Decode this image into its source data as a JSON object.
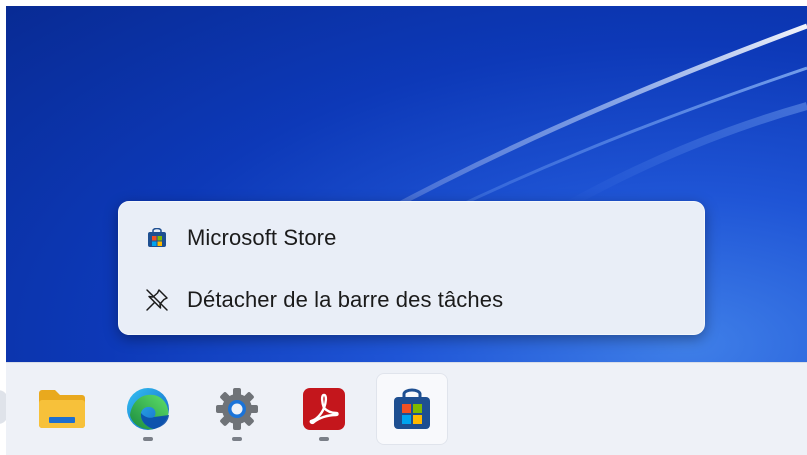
{
  "context_menu": {
    "items": [
      {
        "label": "Microsoft Store",
        "icon": "microsoft-store-icon"
      },
      {
        "label": "Détacher de la barre des tâches",
        "icon": "unpin-icon"
      }
    ]
  },
  "taskbar": {
    "items": [
      {
        "name": "file-explorer",
        "icon": "folder-icon",
        "running": false
      },
      {
        "name": "microsoft-edge",
        "icon": "edge-icon",
        "running": true
      },
      {
        "name": "settings",
        "icon": "gear-icon",
        "running": true
      },
      {
        "name": "acrobat-reader",
        "icon": "pdf-icon",
        "running": true
      },
      {
        "name": "microsoft-store",
        "icon": "microsoft-store-icon",
        "running": false,
        "active": true
      }
    ]
  },
  "colors": {
    "desktop": "#0d39b8",
    "menu_bg": "#e9eef7",
    "taskbar_bg": "#eef1f7",
    "pdf_red": "#c4161c",
    "folder_yellow": "#f7c13a"
  }
}
